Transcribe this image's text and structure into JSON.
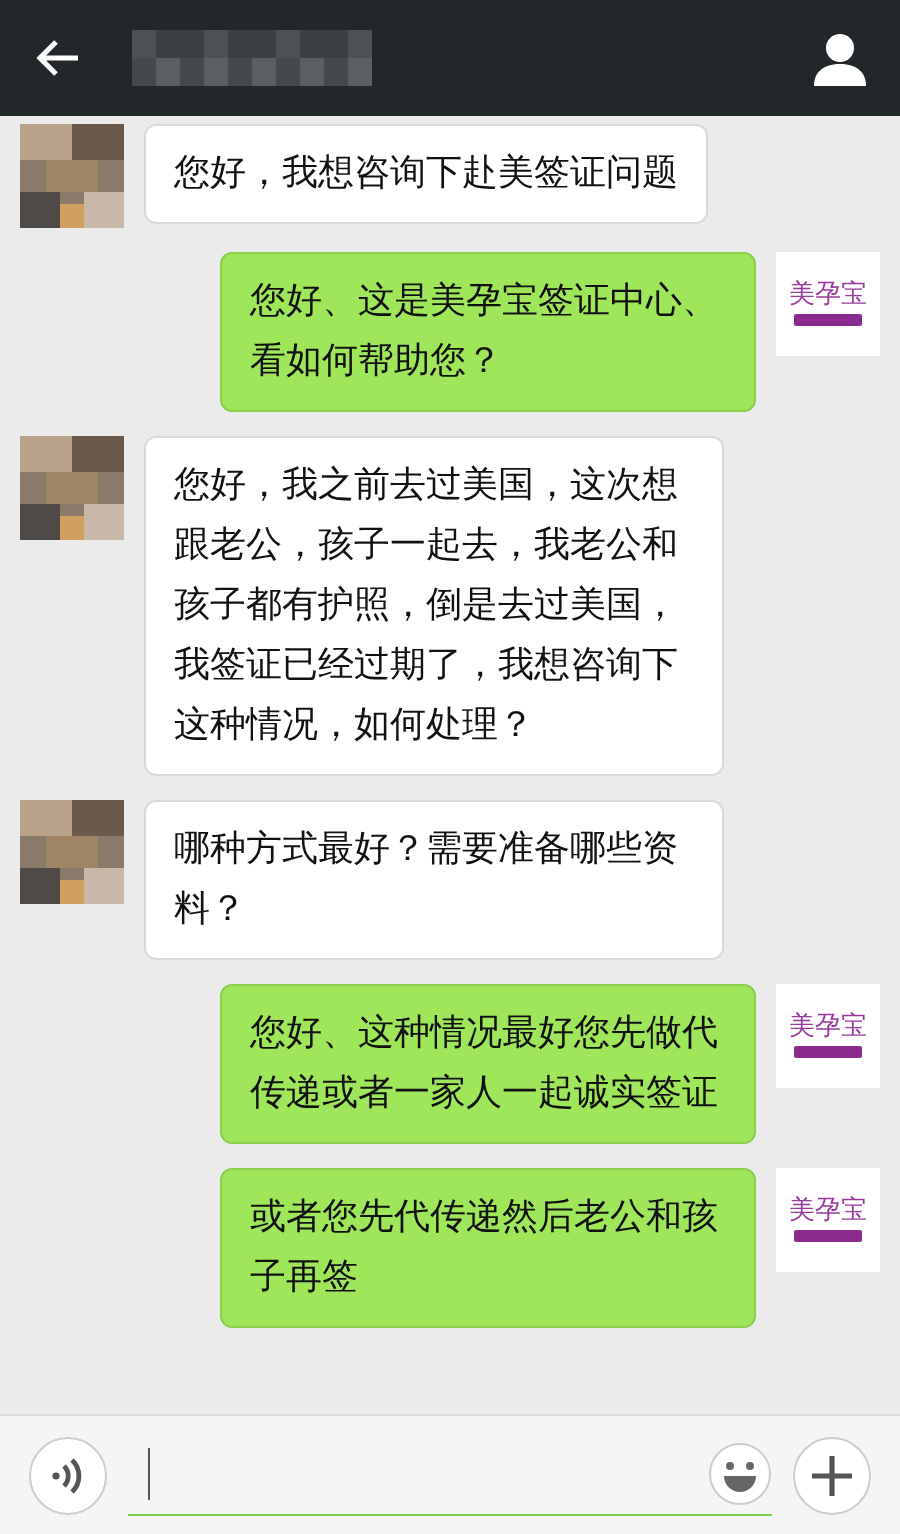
{
  "messages": [
    {
      "kind": "incoming",
      "text": "您好，我想咨询下赴美签证问题"
    },
    {
      "kind": "outgoing",
      "avatar": {
        "kind": "logo",
        "logo_text": "美孕宝"
      },
      "text": "您好、这是美孕宝签证中心、看如何帮助您？"
    },
    {
      "kind": "incoming",
      "text": "您好，我之前去过美国，这次想跟老公，孩子一起去，我老公和孩子都有护照，倒是去过美国，我签证已经过期了，我想咨询下这种情况，如何处理？"
    },
    {
      "kind": "incoming",
      "text": "哪种方式最好？需要准备哪些资料？"
    },
    {
      "kind": "outgoing",
      "avatar": {
        "kind": "logo",
        "logo_text": "美孕宝"
      },
      "text": "您好、这种情况最好您先做代传递或者一家人一起诚实签证"
    },
    {
      "kind": "outgoing",
      "avatar": {
        "kind": "logo",
        "logo_text": "美孕宝"
      },
      "text": "或者您先代传递然后老公和孩子再签"
    }
  ]
}
